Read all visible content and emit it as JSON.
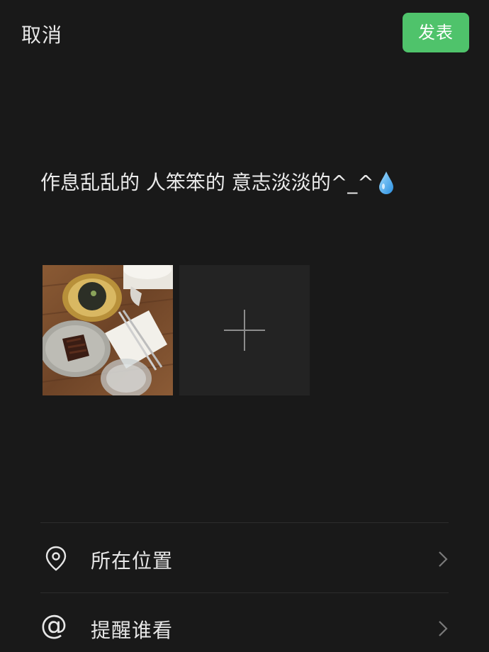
{
  "header": {
    "cancel_label": "取消",
    "publish_label": "发表",
    "publish_color": "#4fc36b"
  },
  "post": {
    "text": "作息乱乱的 人笨笨的 意志淡淡的^_^",
    "emoji_icon": "water-drop-icon"
  },
  "photos": {
    "add_icon": "plus-icon"
  },
  "options": [
    {
      "label": "所在位置",
      "icon": "location-pin-icon"
    },
    {
      "label": "提醒谁看",
      "icon": "at-icon"
    }
  ]
}
